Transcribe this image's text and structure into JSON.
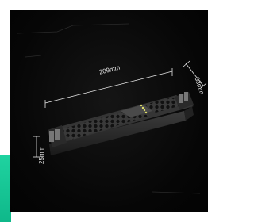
{
  "product_photo": {
    "subject": "slim-led-power-supply",
    "dimensions": {
      "length_label": "209mm",
      "width_label": "63mm",
      "height_label": "25mm"
    }
  },
  "colors": {
    "background": "#ffffff",
    "photo_background": "#060606",
    "accent": "#1fd3a0",
    "dimension_line": "#e8e8e8",
    "housing": "#2b2b2b"
  }
}
